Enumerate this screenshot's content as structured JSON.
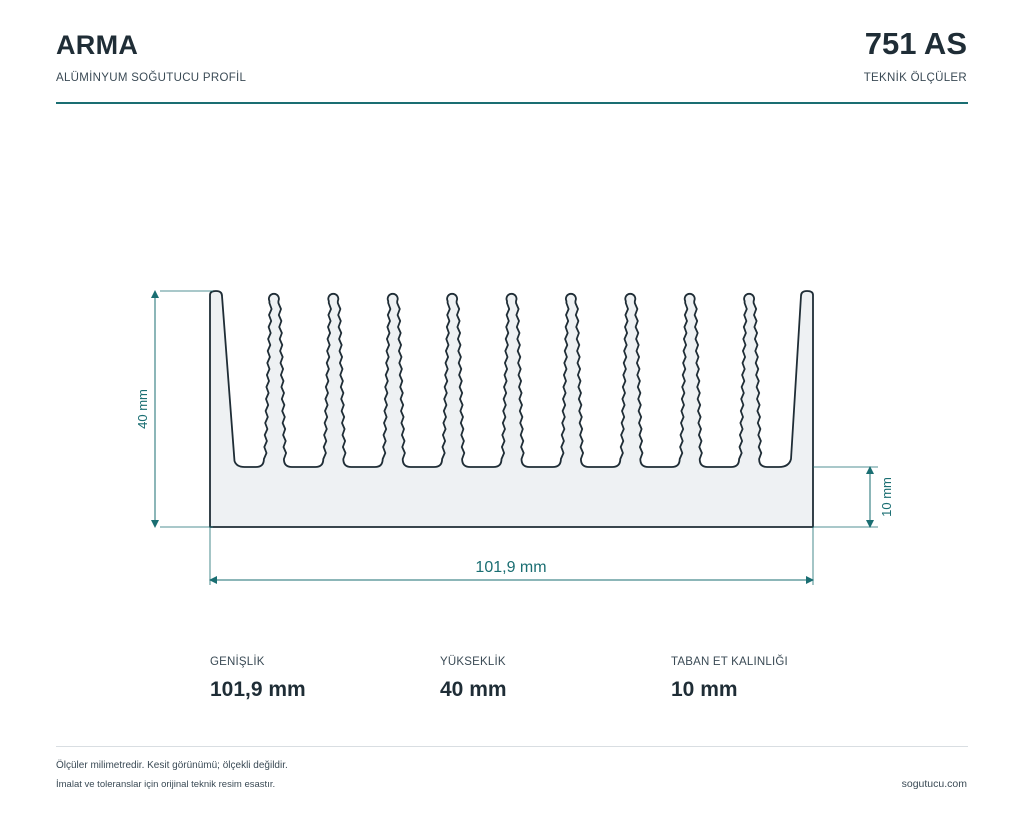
{
  "header": {
    "brand": "ARMA",
    "brand_subtitle": "ALÜMİNYUM SOĞUTUCU PROFİL",
    "product_code": "751 AS",
    "code_subtitle": "TEKNİK ÖLÇÜLER",
    "accent_color": "#1a6e72"
  },
  "drawing": {
    "profile_fill": "#eef1f3",
    "profile_stroke": "#1f2d36",
    "dimension_color": "#1a6e72",
    "fin_count": 11,
    "dimensions": {
      "width_label": "101,9 mm",
      "height_label": "40 mm",
      "base_label": "10 mm"
    }
  },
  "specs": [
    {
      "label": "GENİŞLİK",
      "value": "101,9 mm"
    },
    {
      "label": "YÜKSEKLİK",
      "value": "40 mm"
    },
    {
      "label": "TABAN ET KALINLIĞI",
      "value": "10 mm"
    }
  ],
  "footer": {
    "note_1": "Ölçüler milimetredir. Kesit görünümü; ölçekli değildir.",
    "note_2": "İmalat ve toleranslar için orijinal teknik resim esastır.",
    "website": "sogutucu.com"
  }
}
